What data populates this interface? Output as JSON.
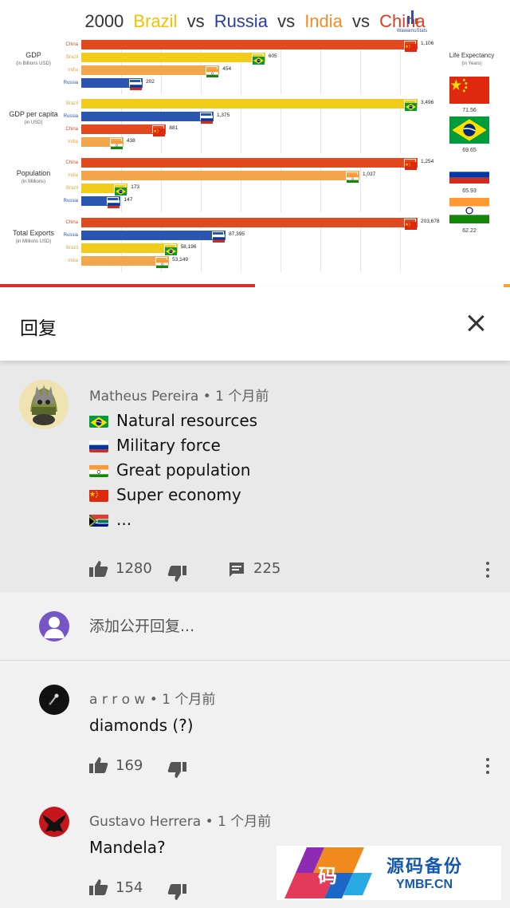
{
  "video": {
    "title": {
      "year": "2000",
      "c1": "Brazil",
      "vs1": "vs",
      "c2": "Russia",
      "vs2": "vs",
      "c3": "India",
      "vs3": "vs",
      "c4": "China"
    },
    "title_colors": {
      "year": "#333333",
      "brazil": "#f2c200",
      "russia": "#2a3f9c",
      "india": "#f08c28",
      "china": "#e03a1e",
      "vs": "#333333"
    },
    "logo_text": "WawamuStats",
    "country_colors": {
      "China": "#e04a1e",
      "Brazil": "#f2cc1b",
      "India": "#f4a64c",
      "Russia": "#2a55b0"
    },
    "life_expectancy": {
      "title": "Life Expectancy",
      "unit": "(in Years)",
      "items": [
        {
          "country": "China",
          "value": "71.56"
        },
        {
          "country": "Brazil",
          "value": "69.65"
        },
        {
          "country": "Russia",
          "value": "65.93"
        },
        {
          "country": "India",
          "value": "62.22"
        }
      ]
    },
    "progress": 0.5
  },
  "chart_data": [
    {
      "type": "bar",
      "title": "GDP",
      "unit": "(in Billions USD)",
      "categories": [
        "China",
        "Brazil",
        "India",
        "Russia"
      ],
      "values": [
        1106,
        605,
        454,
        202
      ],
      "labels": [
        "1,106",
        "605",
        "454",
        "202"
      ],
      "max": 1106
    },
    {
      "type": "bar",
      "title": "GDP per capita",
      "unit": "(in USD)",
      "categories": [
        "Brazil",
        "Russia",
        "China",
        "India"
      ],
      "values": [
        3496,
        1375,
        881,
        438
      ],
      "labels": [
        "3,496",
        "1,375",
        "881",
        "438"
      ],
      "max": 3496
    },
    {
      "type": "bar",
      "title": "Population",
      "unit": "(in Millions)",
      "categories": [
        "China",
        "India",
        "Brazil",
        "Russia"
      ],
      "values": [
        1254,
        1037,
        173,
        147
      ],
      "labels": [
        "1,254",
        "1,037",
        "173",
        "147"
      ],
      "max": 1254
    },
    {
      "type": "bar",
      "title": "Total Exports",
      "unit": "(in Millions USD)",
      "categories": [
        "China",
        "Russia",
        "Brazil",
        "India"
      ],
      "values": [
        203678,
        87395,
        58196,
        53149
      ],
      "labels": [
        "203,678",
        "87,395",
        "58,196",
        "53,149"
      ],
      "max": 203678
    }
  ],
  "panel": {
    "title": "回复",
    "close_icon": "close-icon"
  },
  "main_comment": {
    "author": "Matheus Pereira",
    "time": " • 1 个月前",
    "lines": [
      {
        "flag": "Brazil",
        "text": "Natural resources"
      },
      {
        "flag": "Russia",
        "text": "Military force"
      },
      {
        "flag": "India",
        "text": "Great population"
      },
      {
        "flag": "China",
        "text": "Super economy"
      },
      {
        "flag": "South Africa",
        "text": "..."
      }
    ],
    "likes": "1280",
    "replies": "225"
  },
  "add_reply": {
    "placeholder": "添加公开回复..."
  },
  "replies": [
    {
      "author": "a r r o w",
      "time": " • 1 个月前",
      "text": "diamonds (?)",
      "likes": "169"
    },
    {
      "author": "Gustavo Herrera",
      "time": " • 1 个月前",
      "text": "Mandela?",
      "likes": "154"
    }
  ],
  "watermark": {
    "glyph": "码",
    "text": "源码备份",
    "url": "YMBF.CN"
  }
}
